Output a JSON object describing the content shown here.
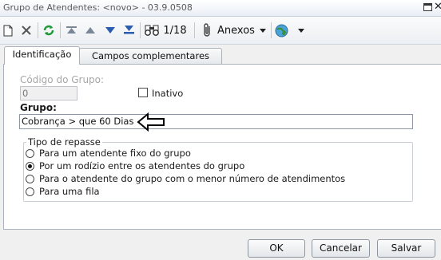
{
  "window": {
    "title": "Grupo de Atendentes: <novo> - 03.9.0508",
    "close_glyph": "✕"
  },
  "toolbar": {
    "record_counter": "1/18",
    "attachments_label": "Anexos",
    "icons": [
      "new-icon",
      "delete-icon",
      "refresh-icon",
      "first-record-icon",
      "previous-record-icon",
      "next-record-icon",
      "last-record-icon",
      "search-icon",
      "attachment-icon",
      "dropdown-icon",
      "globe-icon",
      "dropdown-icon"
    ]
  },
  "tabs": [
    {
      "label": "Identificação",
      "active": true
    },
    {
      "label": "Campos complementares",
      "active": false
    }
  ],
  "form": {
    "group_code_label": "Código do Grupo:",
    "group_code_value": "0",
    "inactive_label": "Inativo",
    "inactive_checked": false,
    "group_label": "Grupo:",
    "group_value": "Cobrança > que 60 Dias"
  },
  "repasse": {
    "legend": "Tipo de repasse",
    "options": [
      {
        "label": "Para um atendente fixo do grupo",
        "selected": false
      },
      {
        "label": "Por um rodízio entre os atendentes do grupo",
        "selected": true
      },
      {
        "label": "Para o atendente do grupo com o menor número de atendimentos",
        "selected": false
      },
      {
        "label": "Para uma fila",
        "selected": false
      }
    ]
  },
  "buttons": {
    "ok": "OK",
    "cancel": "Cancelar",
    "save": "Salvar"
  },
  "colors": {
    "accent_blue": "#2a5db0",
    "refresh_green": "#1f9a3a"
  }
}
